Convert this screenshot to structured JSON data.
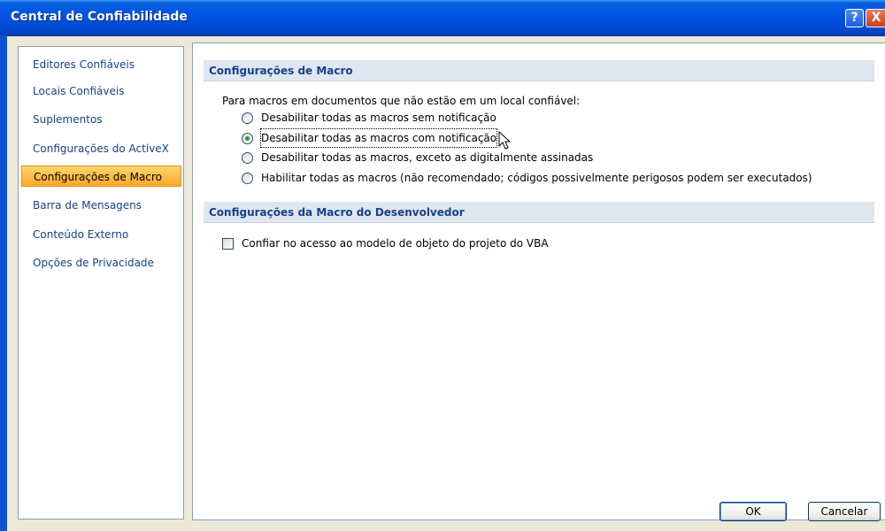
{
  "window": {
    "title": "Central de Confiabilidade",
    "help_label": "?",
    "close_label": "X"
  },
  "nav": {
    "items": [
      {
        "label": "Editores Confiáveis",
        "selected": false
      },
      {
        "label": "Locais Confiáveis",
        "selected": false
      },
      {
        "label": "Suplementos",
        "selected": false
      },
      {
        "label": "Configurações do ActiveX",
        "selected": false
      },
      {
        "label": "Configurações de Macro",
        "selected": true
      },
      {
        "label": "Barra de Mensagens",
        "selected": false
      },
      {
        "label": "Conteúdo Externo",
        "selected": false
      },
      {
        "label": "Opções de Privacidade",
        "selected": false
      }
    ]
  },
  "macro_settings": {
    "header": "Configurações de Macro",
    "intro": "Para macros em documentos que não estão em um local confiável:",
    "options": [
      {
        "label": "Desabilitar todas as macros sem notificação",
        "checked": false
      },
      {
        "label": "Desabilitar todas as macros com notificação",
        "checked": true
      },
      {
        "label": "Desabilitar todas as macros, exceto as digitalmente assinadas",
        "checked": false
      },
      {
        "label": "Habilitar todas as macros (não recomendado; códigos possivelmente perigosos podem ser executados)",
        "checked": false
      }
    ]
  },
  "developer": {
    "header": "Configurações da Macro do Desenvolvedor",
    "checkbox_label": "Confiar no acesso ao modelo de objeto do projeto do VBA",
    "checked": false
  },
  "buttons": {
    "ok": "OK",
    "cancel": "Cancelar"
  },
  "colors": {
    "title_bar": "#0055e5",
    "nav_text": "#15428b",
    "selected_nav": "#fdb43b",
    "section_header_bg": "#dfe6ef"
  }
}
